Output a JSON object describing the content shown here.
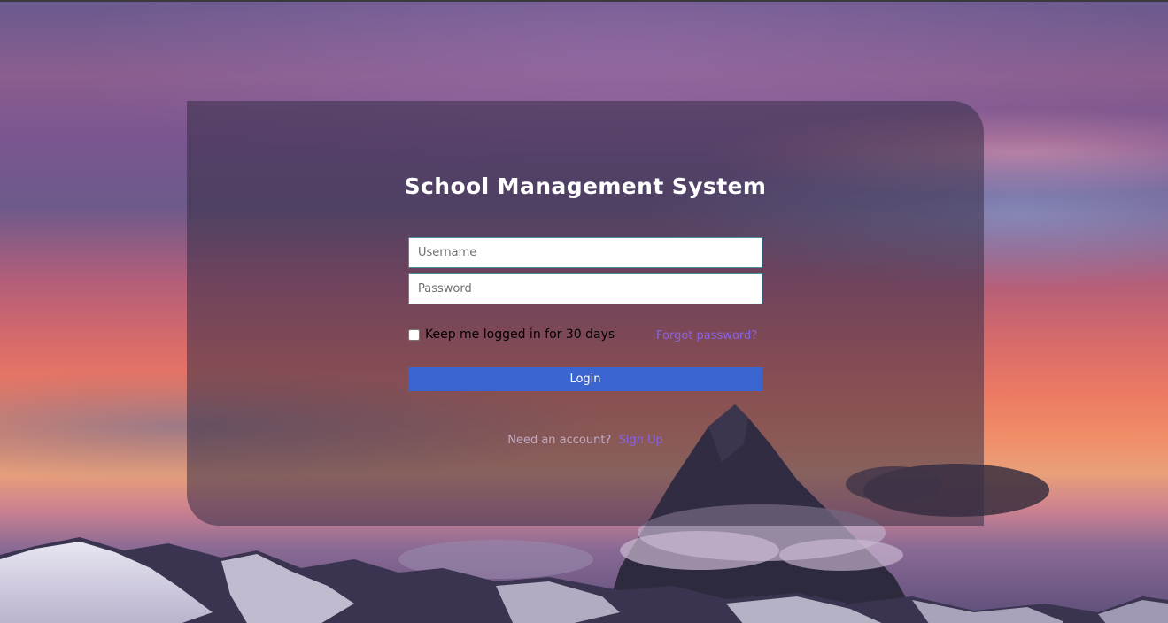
{
  "app": {
    "title": "School Management System"
  },
  "login_form": {
    "username_placeholder": "Username",
    "password_placeholder": "Password",
    "remember_label": "Keep me logged in for 30 days",
    "remember_checked": false,
    "forgot_label": "Forgot password?",
    "login_label": "Login",
    "need_account_text": "Need an account?",
    "signup_label": "Sign Up"
  },
  "colors": {
    "accent": "#3a64cf",
    "link": "#8a63e0",
    "card_overlay": "rgba(55,45,70,0.55)"
  }
}
